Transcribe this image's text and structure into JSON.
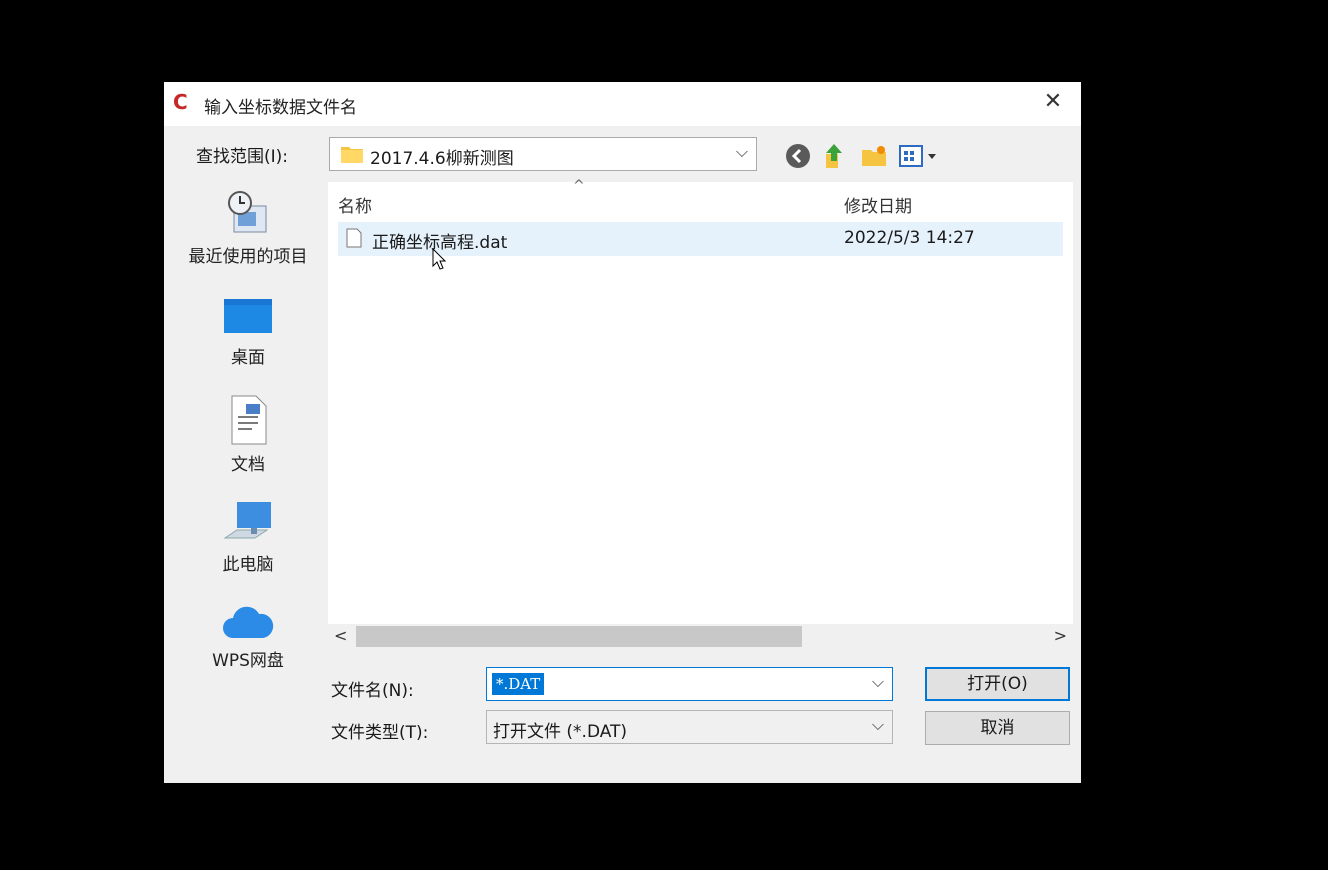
{
  "dialog": {
    "title": "输入坐标数据文件名",
    "app_icon_letter": "C",
    "close_glyph": "✕"
  },
  "lookin": {
    "label": "查找范围(I):",
    "value": "2017.4.6柳新测图"
  },
  "places": [
    {
      "label": "最近使用的项目",
      "icon": "recent-items-icon"
    },
    {
      "label": "桌面",
      "icon": "desktop-icon"
    },
    {
      "label": "文档",
      "icon": "documents-icon"
    },
    {
      "label": "此电脑",
      "icon": "this-pc-icon"
    },
    {
      "label": "WPS网盘",
      "icon": "wps-cloud-icon"
    }
  ],
  "filelist": {
    "columns": {
      "name": "名称",
      "date": "修改日期"
    },
    "rows": [
      {
        "name": "正确坐标高程.dat",
        "date": "2022/5/3 14:27"
      }
    ]
  },
  "filename": {
    "label": "文件名(N):",
    "value": "*.DAT"
  },
  "filetype": {
    "label": "文件类型(T):",
    "value": "打开文件 (*.DAT)"
  },
  "buttons": {
    "open": "打开(O)",
    "cancel": "取消"
  },
  "colors": {
    "accent": "#0078d7",
    "selected_row": "#e5f1fb",
    "app_icon": "#c62828"
  }
}
